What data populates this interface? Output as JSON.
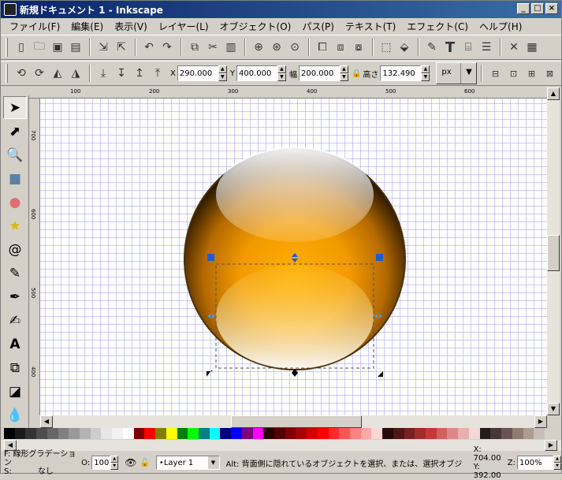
{
  "window": {
    "title": "新規ドキュメント 1 - Inkscape"
  },
  "menu": [
    "ファイル(F)",
    "編集(E)",
    "表示(V)",
    "レイヤー(L)",
    "オブジェクト(O)",
    "パス(P)",
    "テキスト(T)",
    "エフェクト(C)",
    "ヘルプ(H)"
  ],
  "controls": {
    "x_label": "X",
    "x_value": "290.000",
    "y_label": "Y",
    "y_value": "400.000",
    "w_label": "幅",
    "w_value": "200.000",
    "h_label": "高さ",
    "h_value": "132.490",
    "unit": "px"
  },
  "ruler": {
    "h_ticks": [
      "100",
      "200",
      "300",
      "400",
      "500",
      "600"
    ],
    "v_ticks": [
      "700",
      "600",
      "500",
      "400"
    ]
  },
  "palette": [
    "#000000",
    "#1a1a1a",
    "#333333",
    "#4d4d4d",
    "#666666",
    "#808080",
    "#999999",
    "#b3b3b3",
    "#cccccc",
    "#e6e6e6",
    "#f2f2f2",
    "#ffffff",
    "#800000",
    "#ff0000",
    "#808000",
    "#ffff00",
    "#008000",
    "#00ff00",
    "#008080",
    "#00ffff",
    "#000080",
    "#0000ff",
    "#800080",
    "#ff00ff",
    "#2b0000",
    "#550000",
    "#800000",
    "#aa0000",
    "#d40000",
    "#ff0000",
    "#ff2a2a",
    "#ff5555",
    "#ff8080",
    "#ffaaaa",
    "#ffd5d5",
    "#280b0b",
    "#501616",
    "#782121",
    "#a02c2c",
    "#c83737",
    "#d35f5f",
    "#de8787",
    "#e9afaf",
    "#f4d7d7",
    "#241c1c",
    "#483737",
    "#6c5353",
    "#917c6f",
    "#ac9d93",
    "#c8beb7"
  ],
  "status": {
    "fill_label": "F:",
    "fill_value": "線形グラデーション",
    "stroke_label": "S:",
    "stroke_value": "なし",
    "opacity_label": "O:",
    "opacity_value": "100",
    "layer": "•Layer 1",
    "message": "Alt: 背面側に隠れているオブジェクトを選択、または、選択オブジ",
    "x_coord": "X: 704.00",
    "y_coord": "Y: 392.00",
    "zoom_label": "Z:",
    "zoom_value": "100%"
  }
}
